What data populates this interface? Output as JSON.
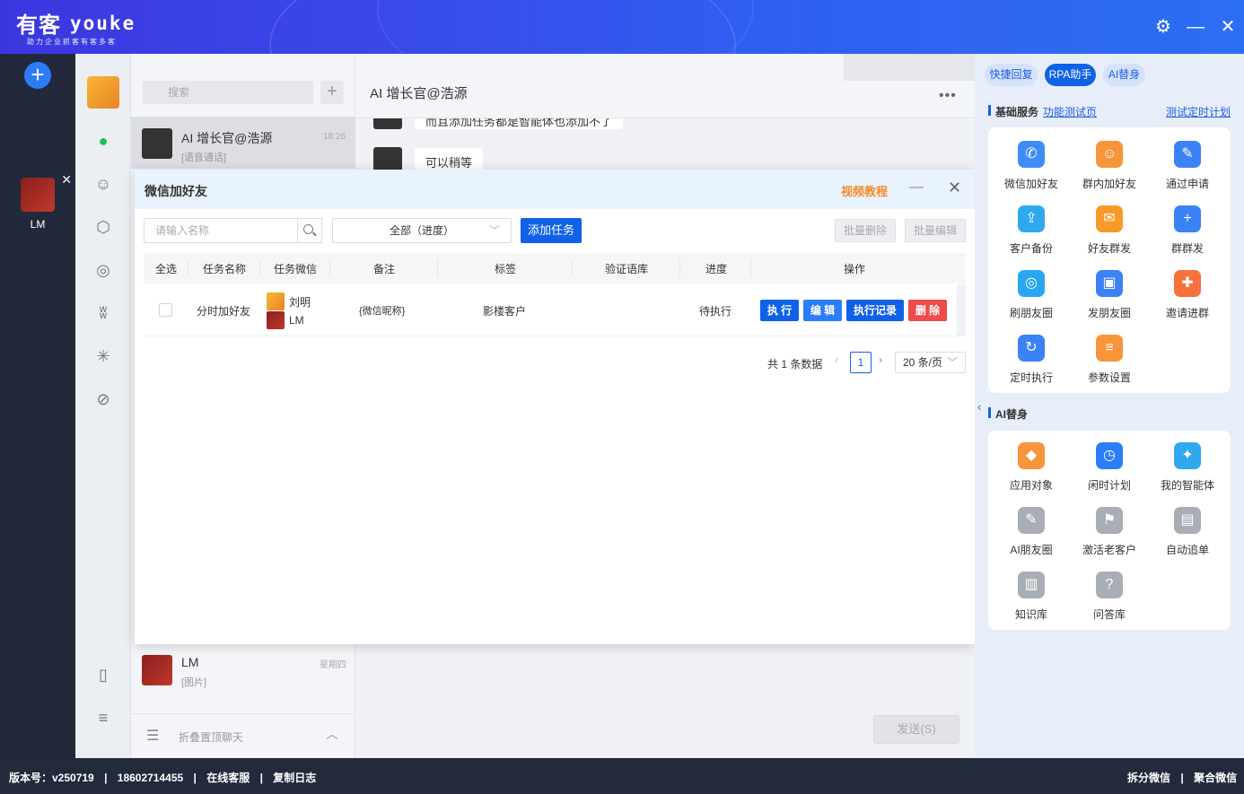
{
  "app": {
    "logo_cn": "有客",
    "logo_en": "youke",
    "slogan": "助力企业抓客有客多客"
  },
  "accounts": [
    {
      "name": "刘明",
      "selected": true
    },
    {
      "name": "LM",
      "selected": false
    }
  ],
  "search": {
    "placeholder": "搜索"
  },
  "chats": [
    {
      "title": "AI 增长官@浩源",
      "sub": "[语音通话]",
      "time": "18:26"
    },
    {
      "title": "LM",
      "sub": "[图片]",
      "time": "星期四"
    }
  ],
  "fold_label": "折叠置顶聊天",
  "chat": {
    "title": "AI 增长官@浩源",
    "msg1": "而且添加任务都是智能体也添加不了",
    "msg2": "可以稍等",
    "send": "发送(S)"
  },
  "dialog": {
    "title": "微信加好友",
    "video": "视频教程",
    "name_placeholder": "请输入名称",
    "progress_select": "全部（进度）",
    "add_task": "添加任务",
    "batch_delete": "批量删除",
    "batch_edit": "批量编辑",
    "headers": [
      "全选",
      "任务名称",
      "任务微信",
      "备注",
      "标签",
      "验证语库",
      "进度",
      "操作"
    ],
    "row": {
      "name": "分时加好友",
      "wechat1": "刘明",
      "wechat2": "LM",
      "remark": "{微信昵称}",
      "tag": "影楼客户",
      "lib": "",
      "progress": "待执行"
    },
    "actions": {
      "run": "执 行",
      "edit": "编 辑",
      "log": "执行记录",
      "delete": "删 除"
    },
    "pager": {
      "total": "共 1 条数据",
      "page": "1",
      "size": "20 条/页"
    }
  },
  "rpa": {
    "tabs": [
      "快捷回复",
      "RPA助手",
      "AI替身"
    ],
    "basic_title": "基础服务",
    "func_test": "功能测试页",
    "timer_test": "测试定时计划",
    "basic": [
      "微信加好友",
      "群内加好友",
      "通过申请",
      "客户备份",
      "好友群发",
      "群群发",
      "刷朋友圈",
      "发朋友圈",
      "邀请进群",
      "定时执行",
      "参数设置"
    ],
    "ai_title": "AI替身",
    "ai": [
      "应用对象",
      "闲时计划",
      "我的智能体",
      "AI朋友圈",
      "激活老客户",
      "自动追单",
      "知识库",
      "问答库"
    ]
  },
  "status": {
    "version": "版本号：v250719",
    "phone": "18602714455",
    "service": "在线客服",
    "copylog": "复制日志",
    "split": "拆分微信",
    "merge": "聚合微信"
  },
  "colors": {
    "primary": "#0f61e8",
    "danger": "#f04a4a",
    "accent": "#f68b2c"
  }
}
